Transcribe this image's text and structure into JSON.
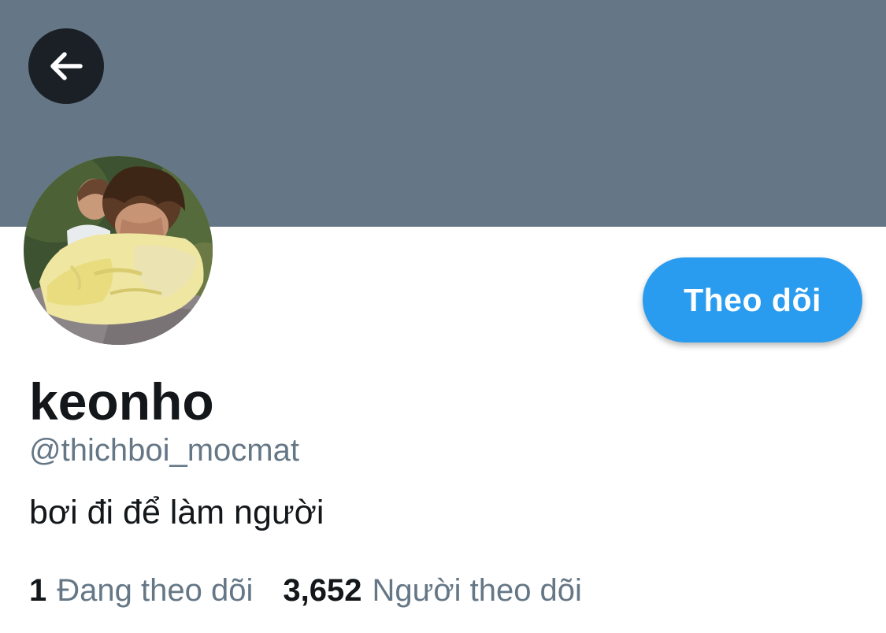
{
  "header": {
    "back_icon": "arrow-left-icon",
    "banner_color": "#657786"
  },
  "profile": {
    "display_name": "keonho",
    "handle": "@thichboi_mocmat",
    "bio": "bơi đi để làm người",
    "follow_label": "Theo dõi",
    "follow_color": "#2a9cf0"
  },
  "stats": {
    "following_count": "1",
    "following_label": "Đang theo dõi",
    "followers_count": "3,652",
    "followers_label": "Người theo dõi"
  }
}
